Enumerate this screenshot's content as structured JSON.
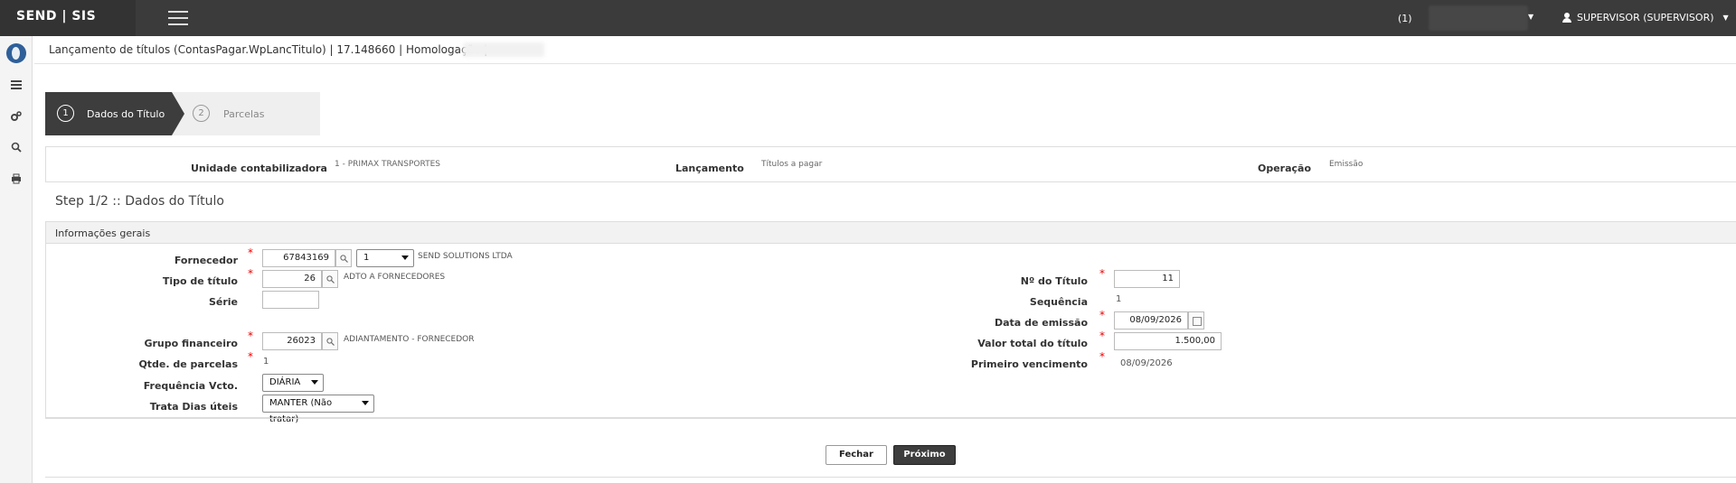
{
  "app": {
    "brand": "SEND | SIS",
    "company_prefix": "(1)",
    "user": "SUPERVISOR (SUPERVISOR)"
  },
  "page": {
    "header": "Lançamento de títulos (ContasPagar.WpLancTitulo) | 17.148660 | Homologação |",
    "step_title": "Step 1/2 :: Dados do Título"
  },
  "wizard": {
    "steps": [
      {
        "num": "1",
        "label": "Dados do Título",
        "active": true
      },
      {
        "num": "2",
        "label": "Parcelas",
        "active": false
      }
    ]
  },
  "info": {
    "unidade_label": "Unidade contabilizadora",
    "unidade_value": "1 - PRIMAX TRANSPORTES",
    "lancamento_label": "Lançamento",
    "lancamento_value": "Títulos a pagar",
    "operacao_label": "Operação",
    "operacao_value": "Emissão"
  },
  "form": {
    "section_title": "Informações gerais",
    "fornecedor": {
      "label": "Fornecedor",
      "code": "67843169",
      "select": "1",
      "desc": "SEND SOLUTIONS LTDA"
    },
    "tipo_titulo": {
      "label": "Tipo de título",
      "value": "26",
      "desc": "ADTO A FORNECEDORES"
    },
    "serie": {
      "label": "Série",
      "value": ""
    },
    "grupo_financeiro": {
      "label": "Grupo financeiro",
      "value": "26023",
      "desc": "ADIANTAMENTO - FORNECEDOR"
    },
    "qtde_parcelas": {
      "label": "Qtde. de parcelas",
      "value": "1"
    },
    "frequencia": {
      "label": "Frequência Vcto.",
      "value": "DIÁRIA"
    },
    "trata_dias": {
      "label": "Trata Dias úteis",
      "value": "MANTER (Não tratar)"
    },
    "num_titulo": {
      "label": "Nº do Título",
      "value": "11"
    },
    "sequencia": {
      "label": "Sequência",
      "value": "1"
    },
    "data_emissao": {
      "label": "Data de emissão",
      "value": "08/09/2026"
    },
    "valor_total": {
      "label": "Valor total do título",
      "value": "1.500,00"
    },
    "primeiro_venc": {
      "label": "Primeiro vencimento",
      "value": "08/09/2026"
    }
  },
  "buttons": {
    "close": "Fechar",
    "next": "Próximo"
  },
  "colors": {
    "topbar": "#3b3b3b",
    "active_step": "#3d3d3d",
    "required": "#e00000"
  }
}
